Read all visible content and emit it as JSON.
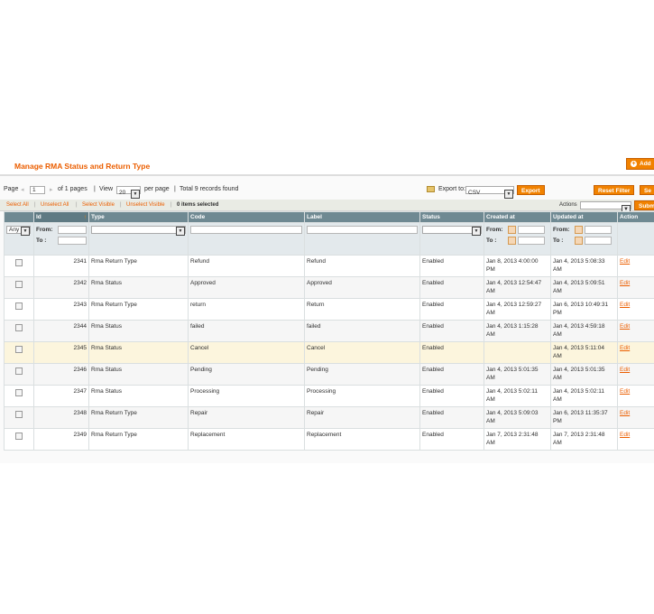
{
  "header": {
    "title": "Manage RMA Status and Return Type",
    "add_button": "Add"
  },
  "pager": {
    "page_label": "Page",
    "page_value": "1",
    "of_pages": "of 1 pages",
    "view_label": "View",
    "per_page_value": "20",
    "per_page_label": "per page",
    "records_found": "Total 9 records found",
    "export_label": "Export to:",
    "export_format": "CSV",
    "export_button": "Export",
    "reset_filter_button": "Reset Filter",
    "search_button": "Se"
  },
  "massaction": {
    "select_all": "Select All",
    "unselect_all": "Unselect All",
    "select_visible": "Select Visible",
    "unselect_visible": "Unselect Visible",
    "separator": "|",
    "items_selected": "0 items selected",
    "actions_label": "Actions",
    "submit_button": "Subm"
  },
  "columns": [
    "Id",
    "Type",
    "Code",
    "Label",
    "Status",
    "Created at",
    "Updated at",
    "Action"
  ],
  "filters": {
    "any_value": "Any",
    "from_label": "From:",
    "to_label": "To :"
  },
  "rows": [
    {
      "id": "2341",
      "type": "Rma Return Type",
      "code": "Refund",
      "label": "Refund",
      "status": "Enabled",
      "created_a": "Jan 8, 2013 4:00:00",
      "created_b": "PM",
      "updated_a": "Jan 4, 2013 5:08:33",
      "updated_b": "AM",
      "action": "Edit"
    },
    {
      "id": "2342",
      "type": "Rma Status",
      "code": "Approved",
      "label": "Approved",
      "status": "Enabled",
      "created_a": "Jan 4, 2013 12:54:47",
      "created_b": "AM",
      "updated_a": "Jan 4, 2013 5:09:51",
      "updated_b": "AM",
      "action": "Edit"
    },
    {
      "id": "2343",
      "type": "Rma Return Type",
      "code": "return",
      "label": "Return",
      "status": "Enabled",
      "created_a": "Jan 4, 2013 12:59:27",
      "created_b": "AM",
      "updated_a": "Jan 6, 2013 10:49:31",
      "updated_b": "PM",
      "action": "Edit"
    },
    {
      "id": "2344",
      "type": "Rma Status",
      "code": "failed",
      "label": "failed",
      "status": "Enabled",
      "created_a": "Jan 4, 2013 1:15:28",
      "created_b": "AM",
      "updated_a": "Jan 4, 2013 4:59:18",
      "updated_b": "AM",
      "action": "Edit"
    },
    {
      "id": "2345",
      "type": "Rma Status",
      "code": "Cancel",
      "label": "Cancel",
      "status": "Enabled",
      "created_a": "",
      "created_b": "",
      "updated_a": "Jan 4, 2013 5:11:04",
      "updated_b": "AM",
      "action": "Edit"
    },
    {
      "id": "2346",
      "type": "Rma Status",
      "code": "Pending",
      "label": "Pending",
      "status": "Enabled",
      "created_a": "Jan 4, 2013 5:01:35",
      "created_b": "AM",
      "updated_a": "Jan 4, 2013 5:01:35",
      "updated_b": "AM",
      "action": "Edit"
    },
    {
      "id": "2347",
      "type": "Rma Status",
      "code": "Processing",
      "label": "Processing",
      "status": "Enabled",
      "created_a": "Jan 4, 2013 5:02:11",
      "created_b": "AM",
      "updated_a": "Jan 4, 2013 5:02:11",
      "updated_b": "AM",
      "action": "Edit"
    },
    {
      "id": "2348",
      "type": "Rma Return Type",
      "code": "Repair",
      "label": "Repair",
      "status": "Enabled",
      "created_a": "Jan 4, 2013 5:09:03",
      "created_b": "AM",
      "updated_a": "Jan 6, 2013 11:35:37",
      "updated_b": "PM",
      "action": "Edit"
    },
    {
      "id": "2349",
      "type": "Rma Return Type",
      "code": "Replacement",
      "label": "Replacement",
      "status": "Enabled",
      "created_a": "Jan 7, 2013 2:31:48",
      "created_b": "AM",
      "updated_a": "Jan 7, 2013 2:31:48",
      "updated_b": "AM",
      "action": "Edit"
    }
  ]
}
